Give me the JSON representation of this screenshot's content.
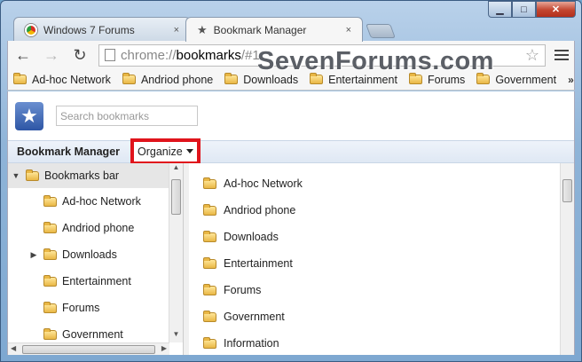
{
  "window": {
    "minimize": "▁",
    "maximize": "□",
    "close": "✕"
  },
  "tabs": [
    {
      "label": "Windows 7 Forums",
      "close": "×",
      "icon": "chrome-icon"
    },
    {
      "label": "Bookmark Manager",
      "close": "×",
      "icon": "star-icon"
    }
  ],
  "toolbar": {
    "url_scheme": "chrome://",
    "url_host": "bookmarks",
    "url_rest": "/#1",
    "watermark": "SevenForums.com"
  },
  "bookmarks_bar": {
    "items": [
      "Ad-hoc Network",
      "Andriod phone",
      "Downloads",
      "Entertainment",
      "Forums",
      "Government"
    ],
    "overflow": "»"
  },
  "manager": {
    "search_placeholder": "Search bookmarks",
    "title": "Bookmark Manager",
    "organize_label": "Organize"
  },
  "tree": {
    "root": "Bookmarks bar",
    "items": [
      {
        "label": "Ad-hoc Network",
        "expandable": false
      },
      {
        "label": "Andriod phone",
        "expandable": false
      },
      {
        "label": "Downloads",
        "expandable": true
      },
      {
        "label": "Entertainment",
        "expandable": false
      },
      {
        "label": "Forums",
        "expandable": false
      },
      {
        "label": "Government",
        "expandable": false
      }
    ]
  },
  "list": {
    "items": [
      "Ad-hoc Network",
      "Andriod phone",
      "Downloads",
      "Entertainment",
      "Forums",
      "Government",
      "Information"
    ]
  },
  "colors": {
    "highlight_border": "#e0141c",
    "accent": "#2e56a5"
  }
}
